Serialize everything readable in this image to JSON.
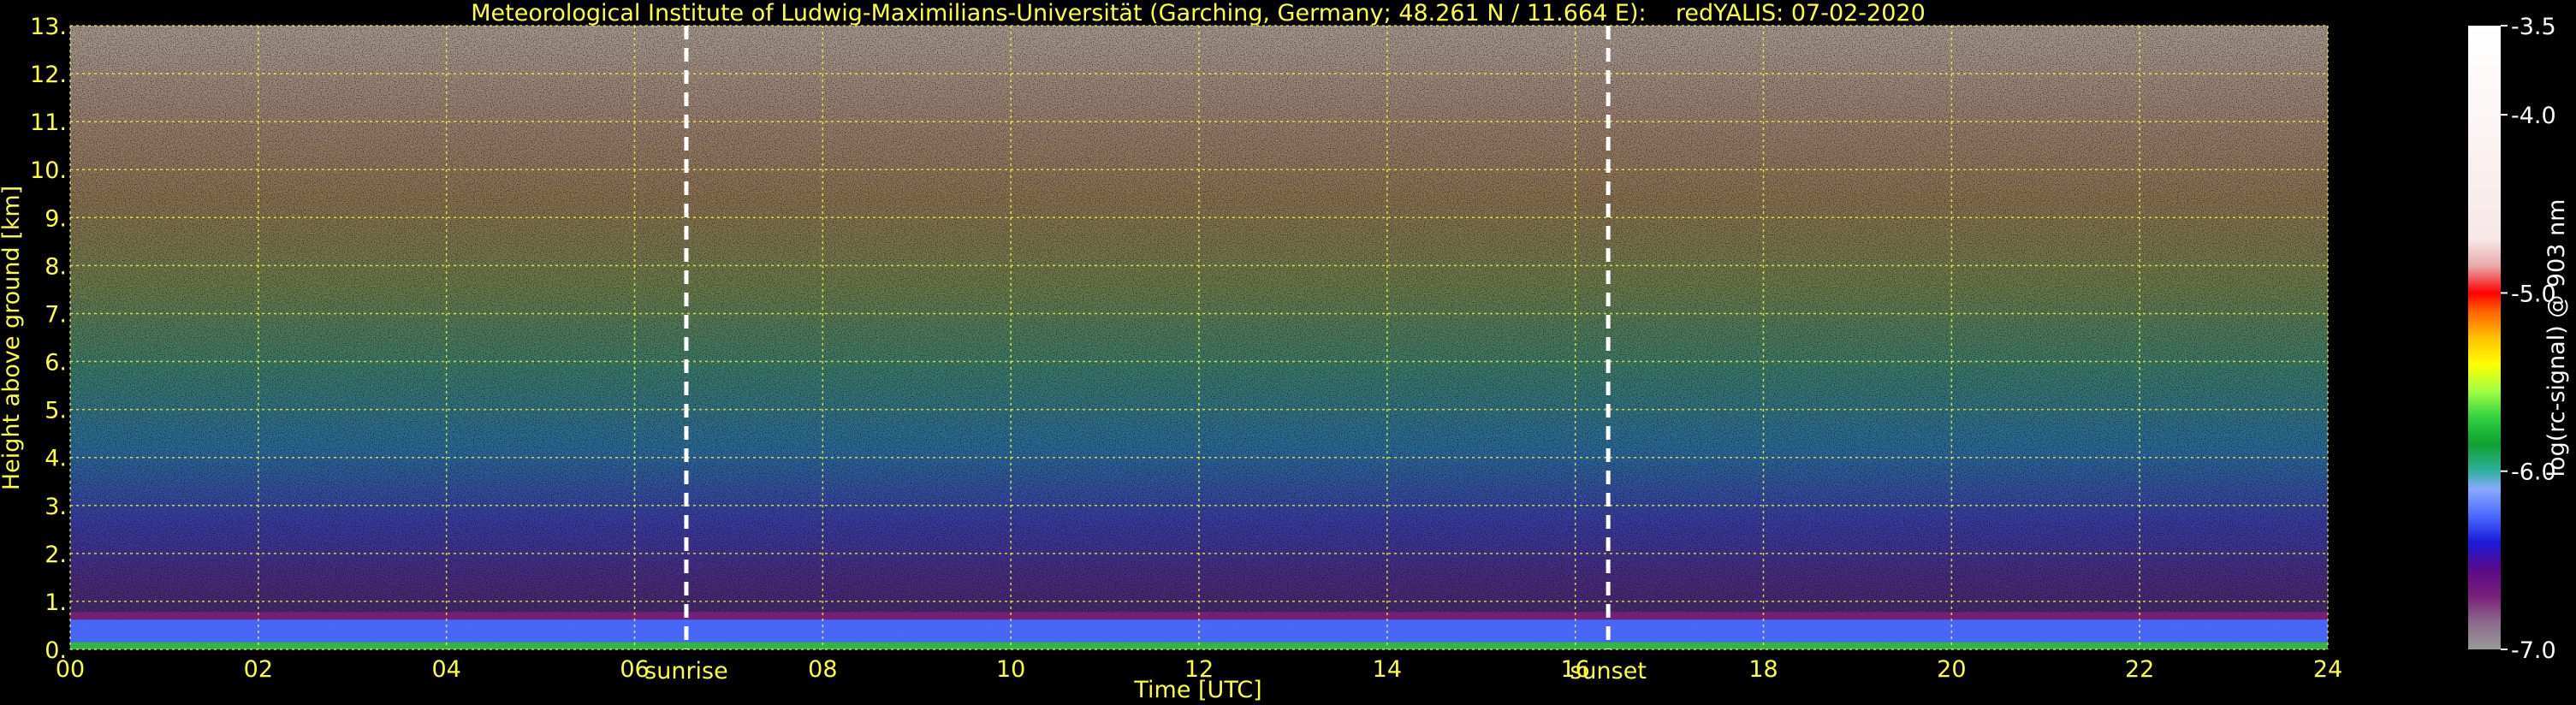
{
  "chart_data": {
    "type": "heatmap",
    "title": "Meteorological Institute of Ludwig-Maximilians-Universität (Garching, Germany; 48.261 N / 11.664 E):    redYALIS: 07-02-2020",
    "xlabel": "Time [UTC]",
    "ylabel": "Height above ground [km]",
    "xlim": [
      0,
      24
    ],
    "ylim": [
      0,
      13
    ],
    "x_ticks": [
      0,
      2,
      4,
      6,
      8,
      10,
      12,
      14,
      16,
      18,
      20,
      22,
      24
    ],
    "x_tick_labels": [
      "00",
      "02",
      "04",
      "06",
      "08",
      "10",
      "12",
      "14",
      "16",
      "18",
      "20",
      "22",
      "24"
    ],
    "y_ticks": [
      0,
      1,
      2,
      3,
      4,
      5,
      6,
      7,
      8,
      9,
      10,
      11,
      12,
      13
    ],
    "y_tick_labels": [
      "0.",
      "1.",
      "2.",
      "3.",
      "4.",
      "5.",
      "6.",
      "7.",
      "8.",
      "9.",
      "10.",
      "11.",
      "12.",
      "13."
    ],
    "grid": true,
    "grid_color": "#ffff33",
    "annotations": [
      {
        "label": "sunrise",
        "x": 6.55
      },
      {
        "label": "sunset",
        "x": 16.35
      }
    ],
    "colorbar": {
      "label": "log(rc-signal) @ 903 nm",
      "min": -7.0,
      "max": -3.5,
      "ticks": [
        -7.0,
        -6.0,
        -5.0,
        -4.0,
        -3.5
      ],
      "tick_labels": [
        "-7.0",
        "-6.0",
        "-5.0",
        "-4.0",
        "-3.5"
      ],
      "colors": [
        {
          "value": -7.0,
          "color": "#9a9a9a"
        },
        {
          "value": -6.85,
          "color": "#8c6a8c"
        },
        {
          "value": -6.7,
          "color": "#7a1f7a"
        },
        {
          "value": -6.55,
          "color": "#5a0a8a"
        },
        {
          "value": -6.4,
          "color": "#1a1ad8"
        },
        {
          "value": -6.25,
          "color": "#4a6aff"
        },
        {
          "value": -6.1,
          "color": "#8aaaff"
        },
        {
          "value": -6.0,
          "color": "#30b0a0"
        },
        {
          "value": -5.85,
          "color": "#10a030"
        },
        {
          "value": -5.7,
          "color": "#30d040"
        },
        {
          "value": -5.55,
          "color": "#a0ff40"
        },
        {
          "value": -5.4,
          "color": "#ffff00"
        },
        {
          "value": -5.25,
          "color": "#ffc000"
        },
        {
          "value": -5.1,
          "color": "#ff6000"
        },
        {
          "value": -5.0,
          "color": "#ff0000"
        },
        {
          "value": -4.85,
          "color": "#e8a8a8"
        },
        {
          "value": -4.7,
          "color": "#f8e8e8"
        },
        {
          "value": -3.5,
          "color": "#ffffff"
        }
      ]
    }
  }
}
